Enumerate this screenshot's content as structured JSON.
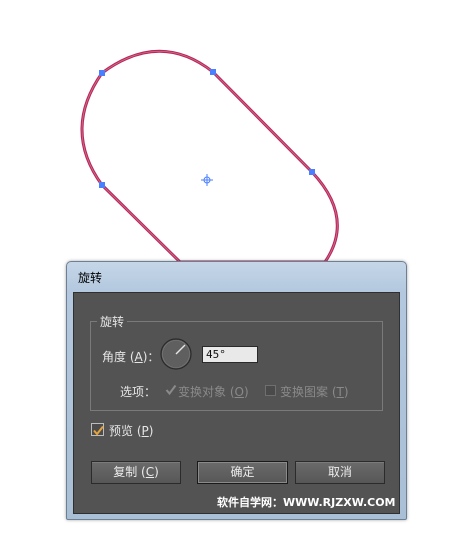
{
  "dialog": {
    "title": "旋转",
    "group_title": "旋转",
    "angle": {
      "label_prefix": "角度 (",
      "mnemonic": "A",
      "label_suffix": ")：",
      "value": "45°"
    },
    "options": {
      "label": "选项：",
      "transform_objects": {
        "label_prefix": "变换对象 (",
        "mnemonic": "O",
        "label_suffix": ")",
        "checked": true,
        "enabled": false
      },
      "transform_patterns": {
        "label_prefix": "变换图案 (",
        "mnemonic": "T",
        "label_suffix": ")",
        "checked": false,
        "enabled": false
      }
    },
    "preview": {
      "label_prefix": "预览 (",
      "mnemonic": "P",
      "label_suffix": ")",
      "checked": true
    },
    "buttons": {
      "copy": {
        "label_prefix": "复制 (",
        "mnemonic": "C",
        "label_suffix": ")"
      },
      "ok": {
        "label": "确定"
      },
      "cancel": {
        "label": "取消"
      }
    },
    "watermark": "软件自学网：WWW.RJZXW.COM"
  },
  "colors": {
    "path_stroke": "#b8285a",
    "anchor_point": "#4a7fff",
    "panel_bg": "#535353",
    "titlebar": "#b3c8de",
    "checkmark": "#e8a23c"
  },
  "icons": {
    "angle_dial": "angle-dial-icon",
    "center_point": "crosshair-icon",
    "checkmark": "checkmark-icon"
  }
}
